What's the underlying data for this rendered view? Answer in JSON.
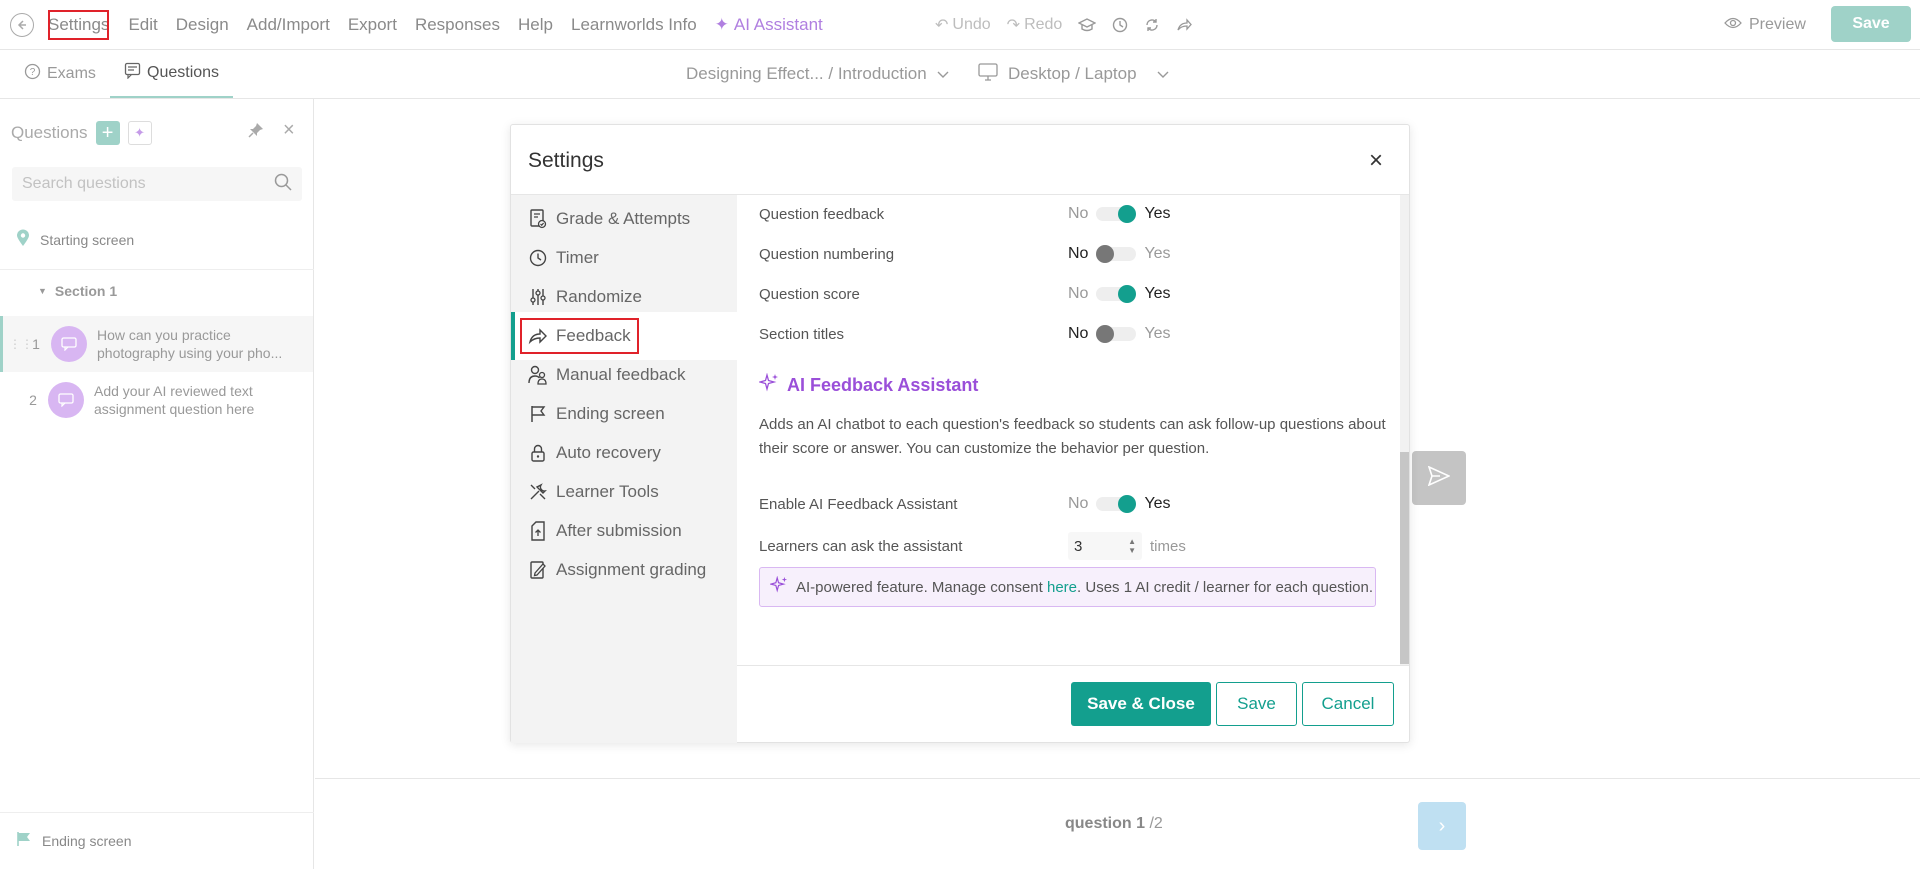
{
  "topbar": {
    "menu": [
      "Settings",
      "Edit",
      "Design",
      "Add/Import",
      "Export",
      "Responses",
      "Help",
      "Learnworlds Info"
    ],
    "ai_assistant": "AI Assistant",
    "undo": "Undo",
    "redo": "Redo",
    "preview": "Preview",
    "save": "Save"
  },
  "subbar": {
    "tab_exams": "Exams",
    "tab_questions": "Questions",
    "breadcrumb": "Designing Effect... / Introduction",
    "device": "Desktop / Laptop"
  },
  "sidebar": {
    "title": "Questions",
    "search_placeholder": "Search questions",
    "starting_screen": "Starting screen",
    "section": "Section 1",
    "questions": [
      {
        "num": "1",
        "text": "How can you practice photography using your pho..."
      },
      {
        "num": "2",
        "text": "Add your AI reviewed text assignment question here"
      }
    ],
    "ending_screen": "Ending screen"
  },
  "canvas": {
    "counter_current": "question 1",
    "counter_total": " /2"
  },
  "modal": {
    "title": "Settings",
    "nav": [
      {
        "label": "Grade & Attempts",
        "icon": "grade-icon"
      },
      {
        "label": "Timer",
        "icon": "clock-icon"
      },
      {
        "label": "Randomize",
        "icon": "sliders-icon"
      },
      {
        "label": "Feedback",
        "icon": "share-arrow-icon"
      },
      {
        "label": "Manual feedback",
        "icon": "users-icon"
      },
      {
        "label": "Ending screen",
        "icon": "flag-icon"
      },
      {
        "label": "Auto recovery",
        "icon": "lock-icon"
      },
      {
        "label": "Learner Tools",
        "icon": "tools-icon"
      },
      {
        "label": "After submission",
        "icon": "upload-doc-icon"
      },
      {
        "label": "Assignment grading",
        "icon": "edit-doc-icon"
      }
    ],
    "settings": [
      {
        "label": "Question feedback",
        "value": "Yes"
      },
      {
        "label": "Question numbering",
        "value": "No"
      },
      {
        "label": "Question score",
        "value": "Yes"
      },
      {
        "label": "Section titles",
        "value": "No"
      }
    ],
    "toggle_no": "No",
    "toggle_yes": "Yes",
    "ai_title": "AI Feedback Assistant",
    "ai_desc": "Adds an AI chatbot to each question's feedback so students can ask follow-up questions about their score or answer. You can customize the behavior per question.",
    "enable_label": "Enable AI Feedback Assistant",
    "enable_value": "Yes",
    "learners_label": "Learners can ask the assistant",
    "learners_value": "3",
    "times": "times",
    "note_prefix": "AI-powered feature. Manage consent ",
    "note_link": "here",
    "note_suffix": ". Uses 1 AI credit / learner for each question.",
    "btn_save_close": "Save & Close",
    "btn_save": "Save",
    "btn_cancel": "Cancel"
  },
  "colors": {
    "accent": "#139f8e",
    "ai_purple": "#9a4fd9",
    "highlight_red": "#e0222a"
  }
}
